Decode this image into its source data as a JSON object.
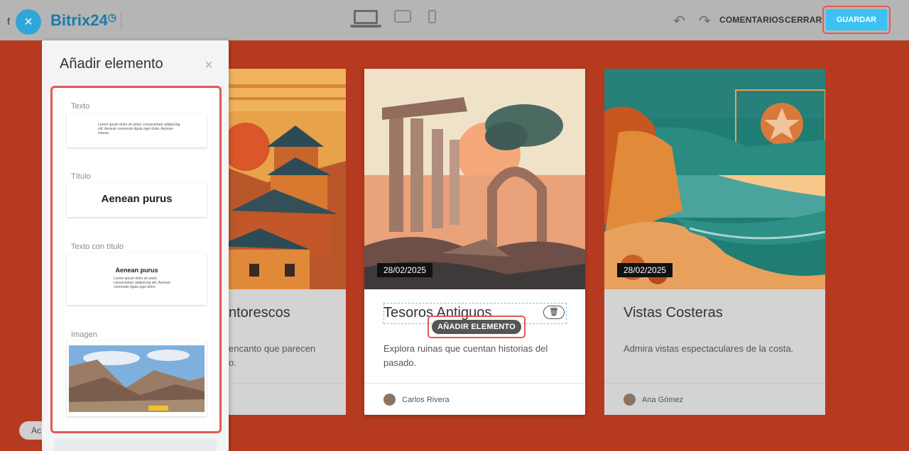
{
  "topbar": {
    "close_icon": "×",
    "partial_text": "f",
    "logo_text": "Bitrix24",
    "logo_clock": "◷",
    "undo_icon": "↶",
    "redo_icon": "↷",
    "comentarios": "COMENTARIOS",
    "cerrar": "CERRAR",
    "guardar": "GUARDAR"
  },
  "panel": {
    "title": "Añadir elemento",
    "close_icon": "×",
    "blocks": [
      {
        "label": "Texto",
        "sample": "Lorem ipsum dolor sit amet, consectetuer adipiscing elit. Aenean commodo ligula eget dolor. Aenean massa."
      },
      {
        "label": "Título",
        "heading": "Aenean purus"
      },
      {
        "label": "Texto con título",
        "heading": "Aenean purus",
        "sample": "Lorem ipsum dolor sit amet, consectetuer adipiscing elit. Aenean commodo ligula eget dolor."
      },
      {
        "label": "Imagen"
      }
    ]
  },
  "cards": [
    {
      "title": "ntorescos",
      "desc": "encanto que parecen\no."
    },
    {
      "date": "28/02/2025",
      "title": "Tesoros Antiguos",
      "desc": "Explora ruinas que cuentan historias del pasado.",
      "author": "Carlos Rivera",
      "add_element": "AÑADIR ELEMENTO",
      "trash_icon": "🗑"
    },
    {
      "date": "28/02/2025",
      "title": "Vistas Costeras",
      "desc": "Admira vistas espectaculares de la costa.",
      "author": "Ana Gómez"
    }
  ],
  "partial_button": "Ac",
  "colors": {
    "background": "#b63a1f",
    "accent_blue": "#3cc2f1",
    "highlight_red": "#e05a55",
    "topbar": "#b5b5b5"
  }
}
